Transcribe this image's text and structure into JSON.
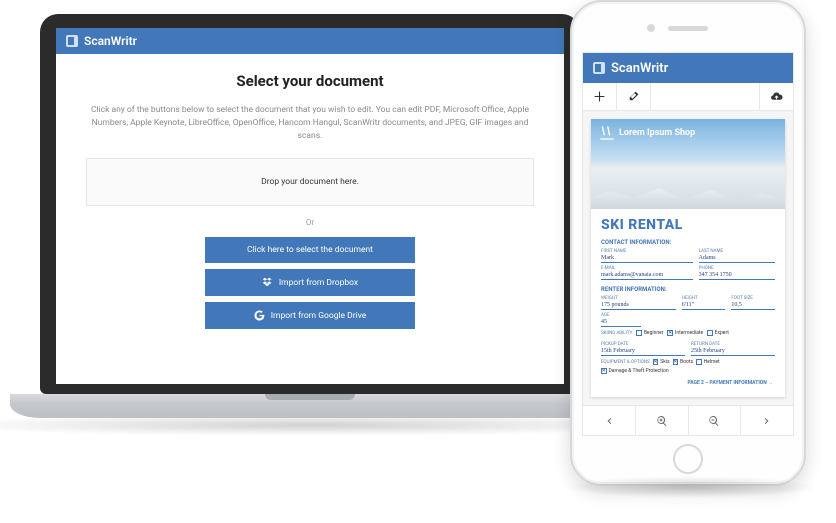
{
  "app_name": "ScanWritr",
  "colors": {
    "primary": "#4278b9"
  },
  "laptop": {
    "heading": "Select your document",
    "description": "Click any of the buttons below to select the document that you wish to edit. You can edit PDF, Microsoft Office, Apple Numbers, Apple Keynote, LibreOffice, OpenOffice, Hancom Hangul, ScanWritr documents, and JPEG, GIF images and scans.",
    "dropzone": "Drop your document here.",
    "or": "Or",
    "btn_select": "Click here to select the document",
    "btn_dropbox": "Import from Dropbox",
    "btn_gdrive": "Import from Google Drive"
  },
  "phone": {
    "toolbar_icons": {
      "add": "add-icon",
      "erase": "eraser-icon",
      "cloud": "cloud-upload-icon"
    },
    "nav_icons": {
      "prev": "chevron-left-icon",
      "zoom_in": "zoom-in-icon",
      "zoom_out": "zoom-out-icon",
      "next": "chevron-right-icon"
    },
    "document": {
      "shop_name": "Lorem Ipsum Shop",
      "title": "SKI RENTAL",
      "sec_contact": "CONTACT INFORMATION:",
      "first_name_label": "First Name",
      "first_name": "Mark",
      "last_name_label": "Last Name",
      "last_name": "Adams",
      "email_label": "E-mail",
      "email": "mark.adams@vanaia.com",
      "phone_label": "Phone",
      "phone": "347 354 1750",
      "sec_renter": "RENTER INFORMATION:",
      "weight_label": "Weight",
      "weight": "175 pounds",
      "height_label": "Height",
      "height": "6'11\"",
      "foot_label": "Foot Size",
      "foot": "10,5",
      "age_label": "Age",
      "age": "45",
      "ability_label": "Skiing Ability",
      "ability_opts": [
        "Beginner",
        "Intermediate",
        "Expert"
      ],
      "ability_checked": 1,
      "pickup_label": "Pickup Date",
      "pickup": "15th February",
      "return_label": "Return Date",
      "return": "25th February",
      "options_label": "Equipment & Options",
      "options": [
        "Skis",
        "Boots",
        "Helmet",
        "Damage & Theft Protection"
      ],
      "options_checked": [
        0,
        1,
        3
      ],
      "footer": "PAGE 2 – PAYMENT INFORMATION →"
    }
  }
}
